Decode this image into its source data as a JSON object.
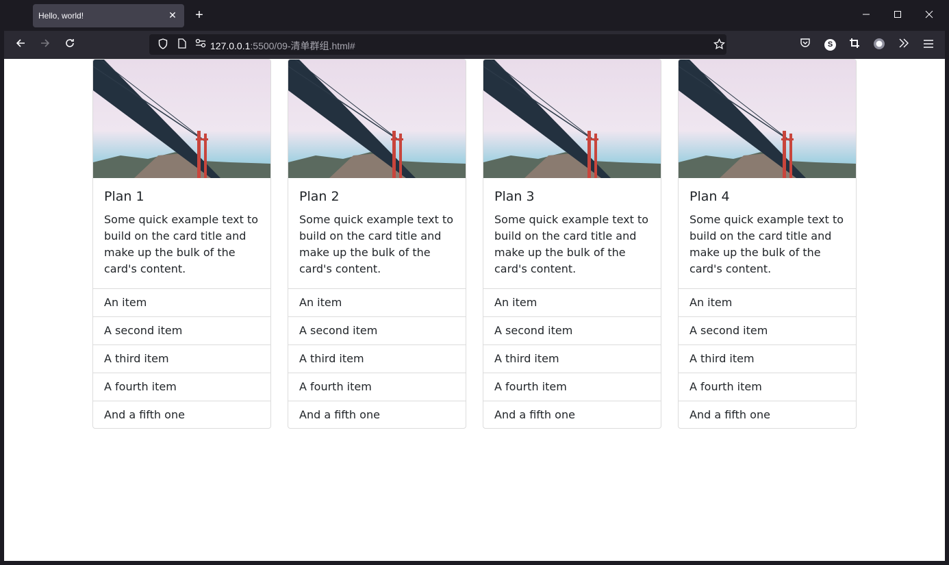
{
  "browser": {
    "tab_title": "Hello, world!",
    "url_host": "127.0.0.1",
    "url_path": ":5500/09-清单群组.html#"
  },
  "cards": [
    {
      "title": "Plan 1",
      "text": "Some quick example text to build on the card title and make up the bulk of the card's content.",
      "items": [
        "An item",
        "A second item",
        "A third item",
        "A fourth item",
        "And a fifth one"
      ]
    },
    {
      "title": "Plan 2",
      "text": "Some quick example text to build on the card title and make up the bulk of the card's content.",
      "items": [
        "An item",
        "A second item",
        "A third item",
        "A fourth item",
        "And a fifth one"
      ]
    },
    {
      "title": "Plan 3",
      "text": "Some quick example text to build on the card title and make up the bulk of the card's content.",
      "items": [
        "An item",
        "A second item",
        "A third item",
        "A fourth item",
        "And a fifth one"
      ]
    },
    {
      "title": "Plan 4",
      "text": "Some quick example text to build on the card title and make up the bulk of the card's content.",
      "items": [
        "An item",
        "A second item",
        "A third item",
        "A fourth item",
        "And a fifth one"
      ]
    }
  ],
  "icons": {
    "back": "back-arrow-icon",
    "forward": "forward-arrow-icon",
    "reload": "reload-icon",
    "shield": "shield-icon",
    "page": "page-icon",
    "permissions": "permissions-icon",
    "bookmark": "star-icon",
    "pocket": "pocket-icon",
    "extension": "extension-icon",
    "crop": "screenshot-icon",
    "record": "record-icon",
    "overflow": "chevrons-icon",
    "menu": "hamburger-menu-icon"
  }
}
